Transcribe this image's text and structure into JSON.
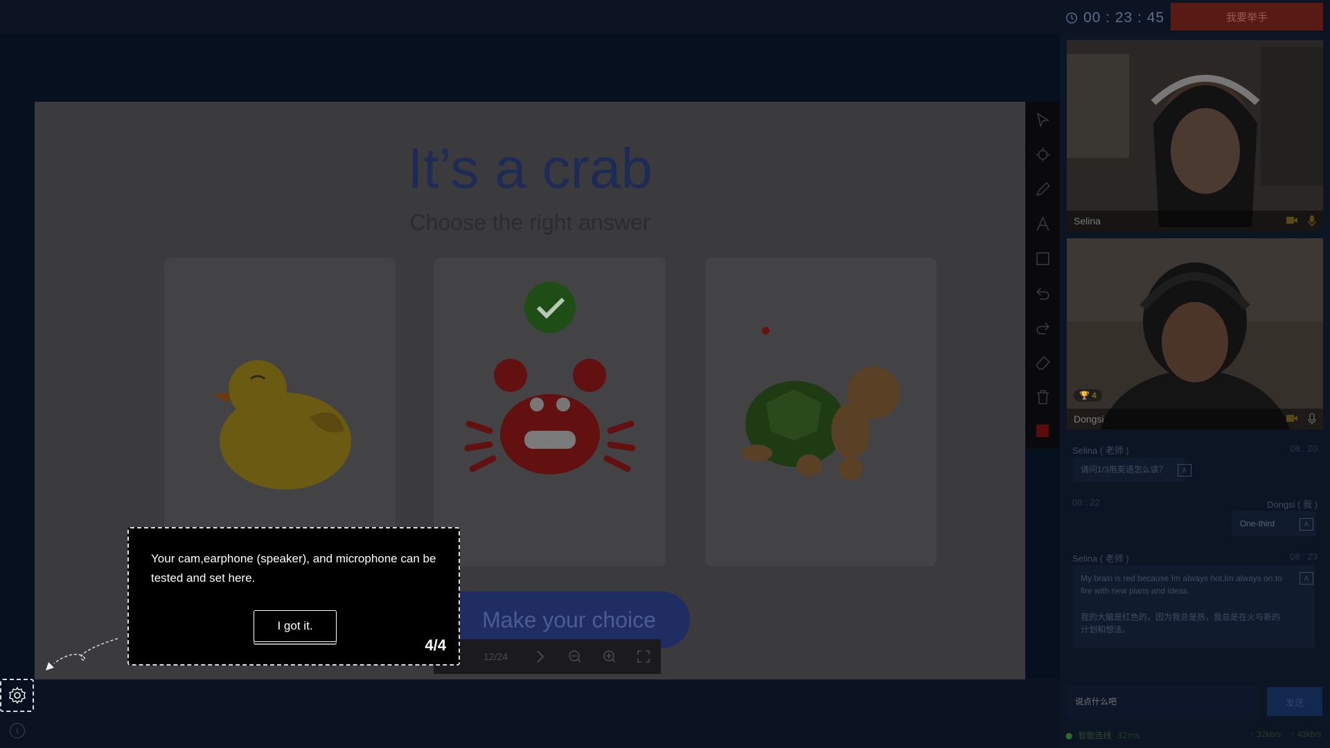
{
  "header": {
    "timer": "00 : 23 : 45",
    "raise_hand_label": "我要举手"
  },
  "slide": {
    "title": "It’s a crab",
    "subtitle": "Choose the right answer",
    "choice_button": "Make your choice",
    "page": "12/24"
  },
  "videos": [
    {
      "name": "Selina"
    },
    {
      "name": "Dongsi",
      "trophies": "4"
    }
  ],
  "chat": {
    "messages": [
      {
        "sender": "Selina ( 老师 )",
        "time": "08 : 20",
        "text": "请问1/3用英语怎么读？"
      },
      {
        "sender": "Dongsi ( 我 )",
        "time": "08 : 22",
        "text": "One-third"
      },
      {
        "sender": "Selina ( 老师 )",
        "time": "08 : 23",
        "text": "My brain is red because Im always hot.Im always on to fire with new plans and ideas.",
        "translation": "我的大脑是红色的，因为我总是热，我总是在火与新的计划和想法。"
      }
    ],
    "input_placeholder": "说点什么吧",
    "send_label": "发送"
  },
  "status": {
    "connection": "智能连线",
    "latency": "32ms",
    "upload": "↑ 32kb/s",
    "download": "↑ 43kb/s"
  },
  "tooltip": {
    "text": "Your cam,earphone (speaker), and microphone can be tested and set here.",
    "button": "I got it.",
    "step": "4/4"
  },
  "colors": {
    "accent_red": "#5a1a14",
    "brand_blue": "#1f2d63",
    "correct_green": "#1e4d16"
  },
  "icons": [
    "clock-icon",
    "pointer-icon",
    "crosshair-icon",
    "pencil-icon",
    "text-icon",
    "rectangle-icon",
    "undo-icon",
    "redo-icon",
    "eraser-icon",
    "trash-icon",
    "color-swatch-icon",
    "camera-icon",
    "microphone-icon",
    "trophy-icon",
    "translate-icon",
    "gear-icon",
    "info-icon",
    "prev-icon",
    "next-icon",
    "zoom-out-icon",
    "zoom-in-icon",
    "fullscreen-icon"
  ]
}
